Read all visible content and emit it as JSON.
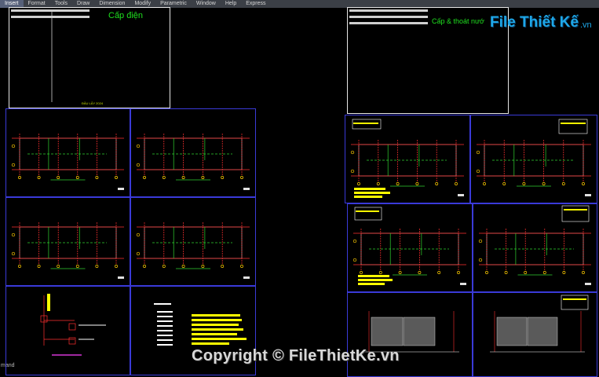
{
  "menu": [
    "Insert",
    "Format",
    "Tools",
    "Draw",
    "Dimension",
    "Modify",
    "Parametric",
    "Window",
    "Help",
    "Express"
  ],
  "active_menu_index": 0,
  "status_text": "mand",
  "cover_left": {
    "title": "Cấp điện",
    "footer": "ĐẦU LẤY 2024"
  },
  "cover_right": {
    "title": "Cấp & thoát nướ"
  },
  "watermark": "Copyright © FileThietKe.vn",
  "logo": {
    "text": "File Thiết Kế",
    "suffix": ".vn"
  },
  "colors": {
    "background": "#000000",
    "sheet_border": "#3a3ad8",
    "cover_border": "#e6e6e6",
    "cad_green": "#1fe01f",
    "cad_yellow": "#ffff00",
    "logo_blue": "#1ea7e8"
  }
}
